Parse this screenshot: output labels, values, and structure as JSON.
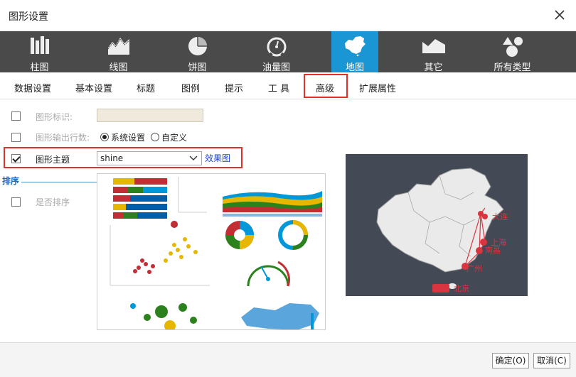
{
  "window": {
    "title": "图形设置"
  },
  "chart_types": [
    {
      "label": "柱图",
      "icon": "bar-chart-icon"
    },
    {
      "label": "线图",
      "icon": "area-chart-icon"
    },
    {
      "label": "饼图",
      "icon": "pie-chart-icon"
    },
    {
      "label": "油量图",
      "icon": "gauge-icon"
    },
    {
      "label": "地图",
      "icon": "china-map-icon",
      "active": true
    },
    {
      "label": "其它",
      "icon": "other-chart-icon"
    },
    {
      "label": "所有类型",
      "icon": "all-types-icon"
    }
  ],
  "sub_tabs": [
    {
      "label": "数据设置"
    },
    {
      "label": "基本设置"
    },
    {
      "label": "标题"
    },
    {
      "label": "图例"
    },
    {
      "label": "提示"
    },
    {
      "label": "工 具"
    },
    {
      "label": "高级",
      "active": true
    },
    {
      "label": "扩展属性"
    }
  ],
  "form": {
    "chart_id_label": "图形标识:",
    "chart_id_value": "",
    "output_rows_label": "图形输出行数:",
    "output_rows_options": [
      "系统设置",
      "自定义"
    ],
    "output_rows_selected": "系统设置",
    "theme_label": "图形主题",
    "theme_checked": true,
    "theme_value": "shine",
    "effect_link": "效果图"
  },
  "sort_section": {
    "title": "排序",
    "enable_label": "是否排序",
    "enable_checked": false
  },
  "map_preview": {
    "cities": [
      "大连",
      "上海",
      "南昌",
      "广州"
    ],
    "legend": "北京",
    "accent_color": "#d9343f",
    "background_color": "#444a55"
  },
  "buttons": {
    "ok": "确定(O)",
    "cancel": "取消(C)"
  },
  "colors": {
    "accent": "#1a96d4",
    "highlight": "#e0322b",
    "tabbar": "#4a4a4a"
  }
}
